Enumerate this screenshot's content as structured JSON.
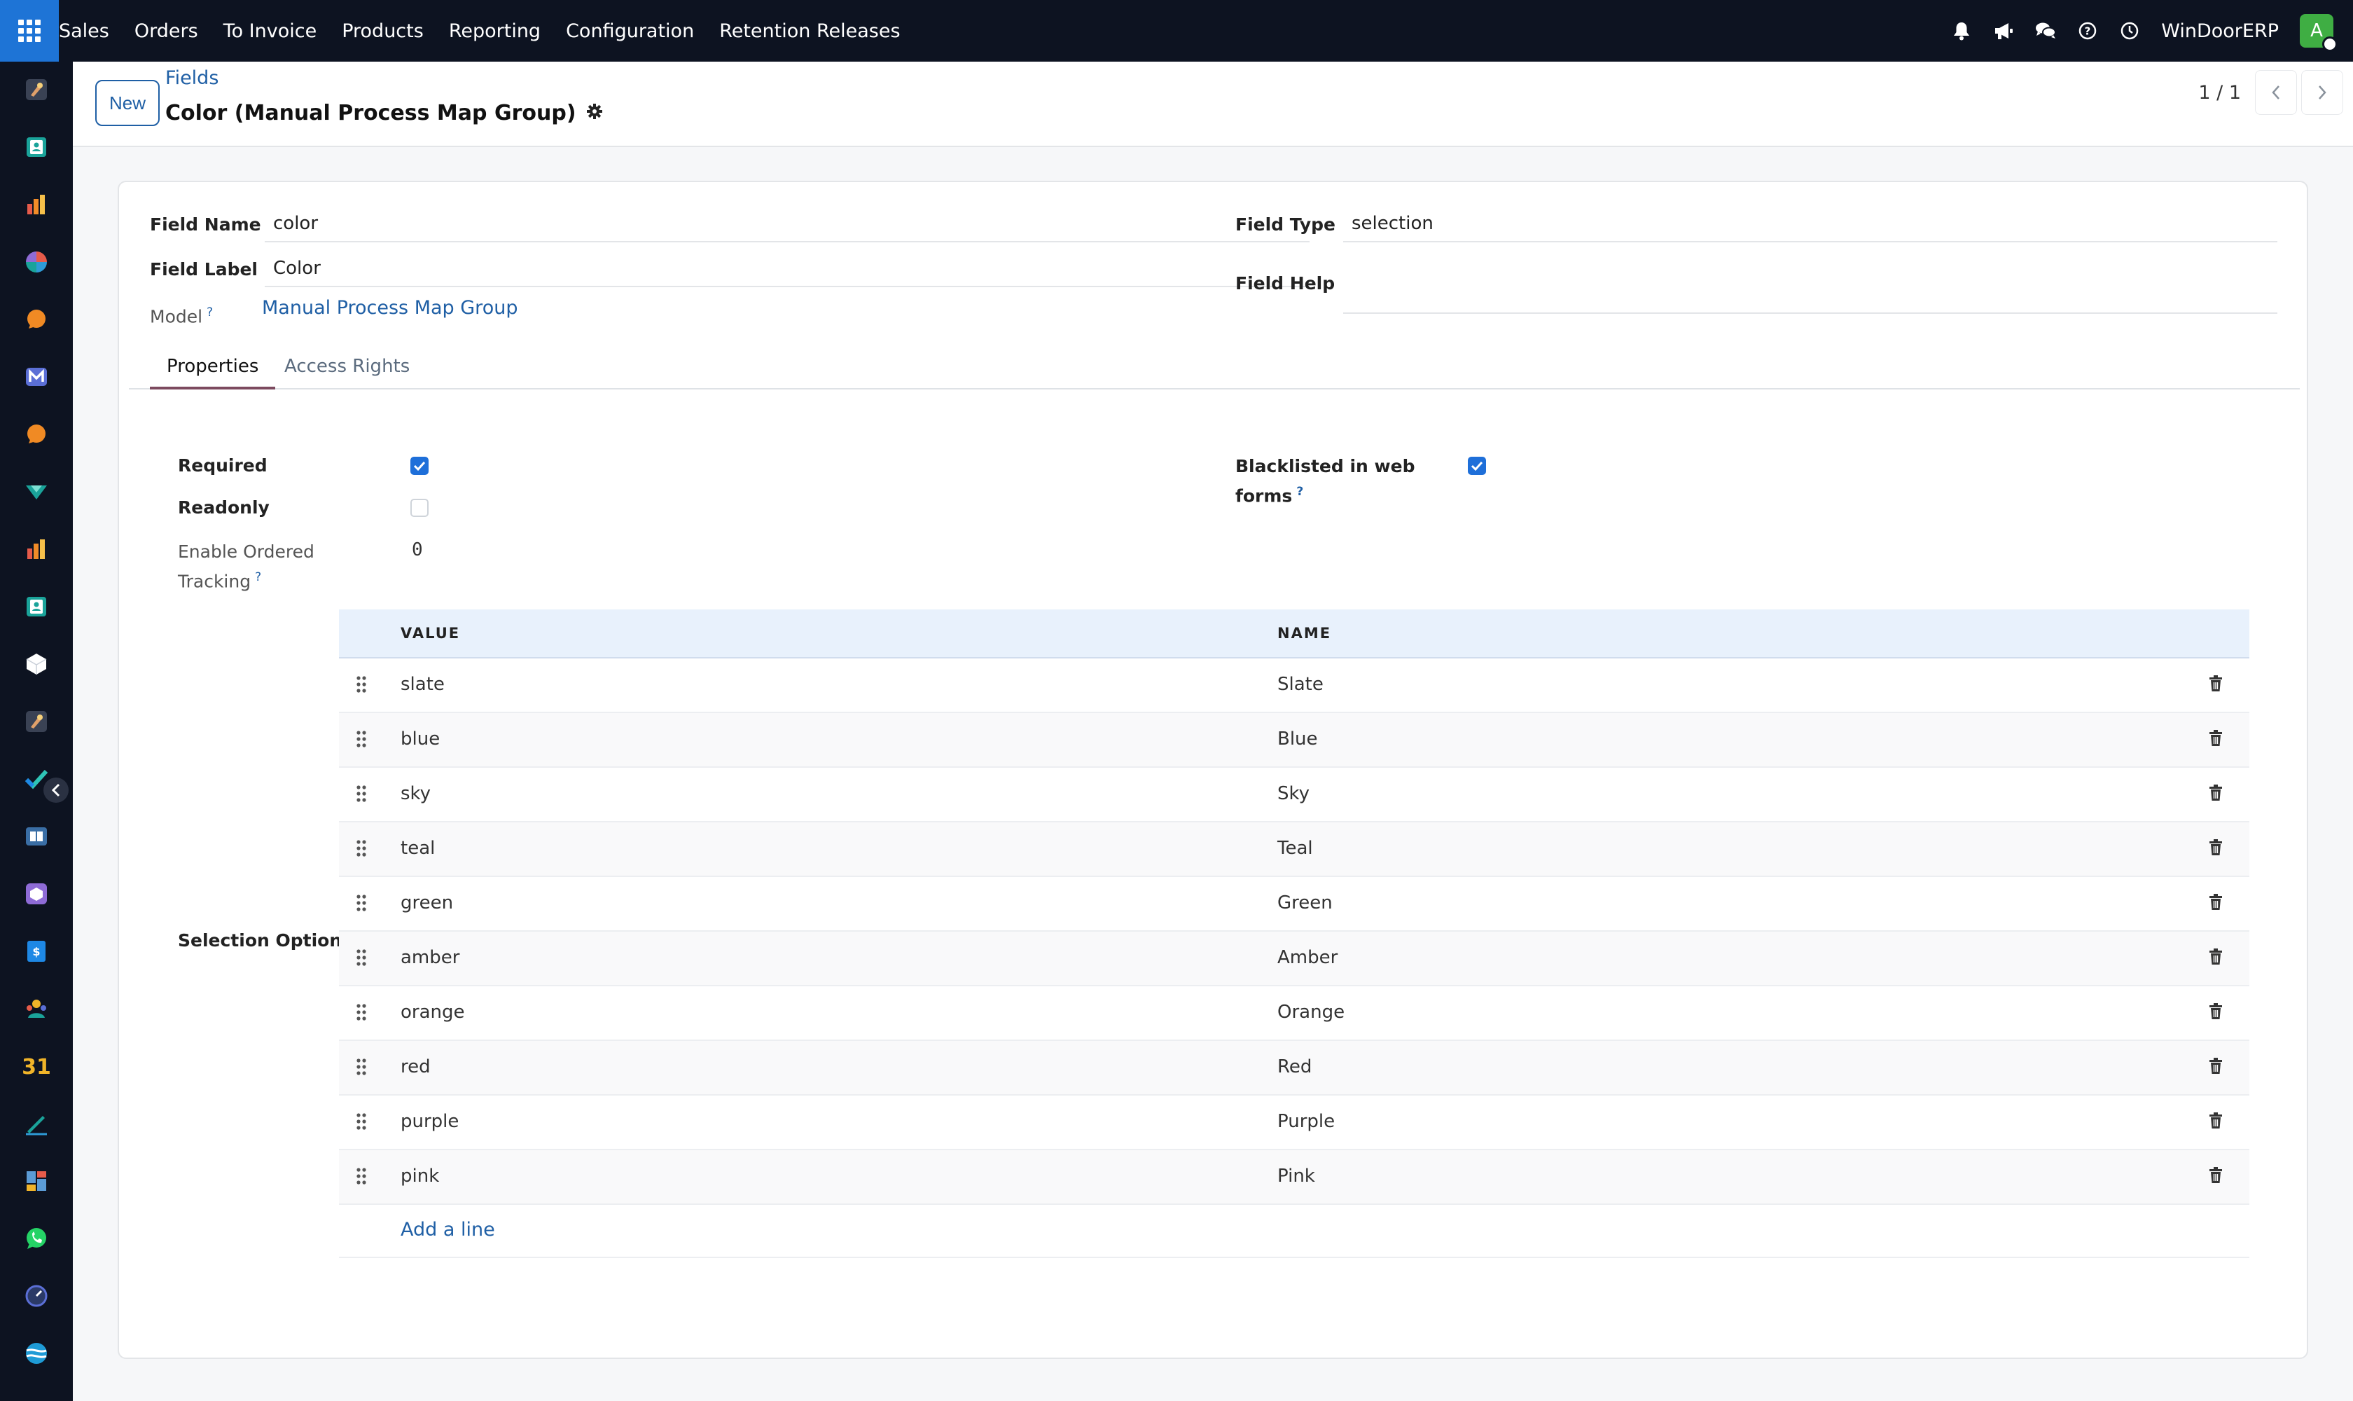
{
  "topbar": {
    "menu": [
      "Sales",
      "Orders",
      "To Invoice",
      "Products",
      "Reporting",
      "Configuration",
      "Retention Releases"
    ],
    "company": "WinDoorERP",
    "avatar_initial": "A"
  },
  "sidebar": {
    "apps": [
      {
        "icon": "app-cookbook-icon",
        "color": "#e0a06a"
      },
      {
        "icon": "app-contacts-icon",
        "color": "#1aa39a"
      },
      {
        "icon": "app-reporting-icon",
        "color": "#f28c28"
      },
      {
        "icon": "app-discuss-icon",
        "color": "#2e9bd6"
      },
      {
        "icon": "app-chat-icon",
        "color": "#f08a24"
      },
      {
        "icon": "app-mail-icon",
        "color": "#5b6fd6"
      },
      {
        "icon": "app-livechat-icon",
        "color": "#f08a24"
      },
      {
        "icon": "app-inventory-icon",
        "color": "#1aa39a"
      },
      {
        "icon": "app-stats-icon",
        "color": "#f28c28"
      },
      {
        "icon": "app-employees-icon",
        "color": "#1aa39a"
      },
      {
        "icon": "app-product-icon",
        "color": "#ffffff"
      },
      {
        "icon": "app-craft-icon",
        "color": "#e0a06a"
      },
      {
        "icon": "app-tasks-icon",
        "color": "#2ec4b6"
      },
      {
        "icon": "app-knowledge-icon",
        "color": "#5b9bd5"
      },
      {
        "icon": "app-packages-icon",
        "color": "#8e6bd6"
      },
      {
        "icon": "app-billing-icon",
        "color": "#1e88e5"
      },
      {
        "icon": "app-team-icon",
        "color": "#f0b429"
      },
      {
        "icon": "app-calendar-icon",
        "color": "#f0b429"
      },
      {
        "icon": "app-sign-icon",
        "color": "#1aa39a"
      },
      {
        "icon": "app-dashboard-icon",
        "color": "#5b9bd5"
      },
      {
        "icon": "app-whatsapp-icon",
        "color": "#25d366"
      },
      {
        "icon": "app-timer-icon",
        "color": "#5b6fd6"
      },
      {
        "icon": "app-sphere-icon",
        "color": "#1e9bd6"
      }
    ]
  },
  "control": {
    "new_label": "New",
    "breadcrumb": "Fields",
    "title": "Color (Manual Process Map Group)",
    "pager": "1 / 1"
  },
  "form": {
    "field_name_label": "Field Name",
    "field_name_value": "color",
    "field_label_label": "Field Label",
    "field_label_value": "Color",
    "model_label": "Model",
    "model_help": "?",
    "model_value": "Manual Process Map Group",
    "field_type_label": "Field Type",
    "field_type_value": "selection",
    "field_help_label": "Field Help",
    "field_help_value": ""
  },
  "tabs": [
    {
      "label": "Properties",
      "active": true
    },
    {
      "label": "Access Rights",
      "active": false
    }
  ],
  "properties": {
    "required_label": "Required",
    "required": true,
    "readonly_label": "Readonly",
    "readonly": false,
    "ordered_tracking_label_1": "Enable Ordered",
    "ordered_tracking_label_2": "Tracking",
    "ordered_tracking_help": "?",
    "ordered_tracking_value": "0",
    "blacklisted_label_1": "Blacklisted in web",
    "blacklisted_label_2": "forms",
    "blacklisted_help": "?",
    "blacklisted": true,
    "selection_options_label": "Selection Options"
  },
  "selection_table": {
    "columns": [
      "VALUE",
      "NAME"
    ],
    "rows": [
      {
        "value": "slate",
        "name": "Slate"
      },
      {
        "value": "blue",
        "name": "Blue"
      },
      {
        "value": "sky",
        "name": "Sky"
      },
      {
        "value": "teal",
        "name": "Teal"
      },
      {
        "value": "green",
        "name": "Green"
      },
      {
        "value": "amber",
        "name": "Amber"
      },
      {
        "value": "orange",
        "name": "Orange"
      },
      {
        "value": "red",
        "name": "Red"
      },
      {
        "value": "purple",
        "name": "Purple"
      },
      {
        "value": "pink",
        "name": "Pink"
      }
    ],
    "add_line_label": "Add a line"
  },
  "colors": {
    "accent": "#1f5fa5",
    "navbar": "#0d1321",
    "checkbox": "#1e6fd9",
    "tab_active": "#7c4a5f"
  }
}
